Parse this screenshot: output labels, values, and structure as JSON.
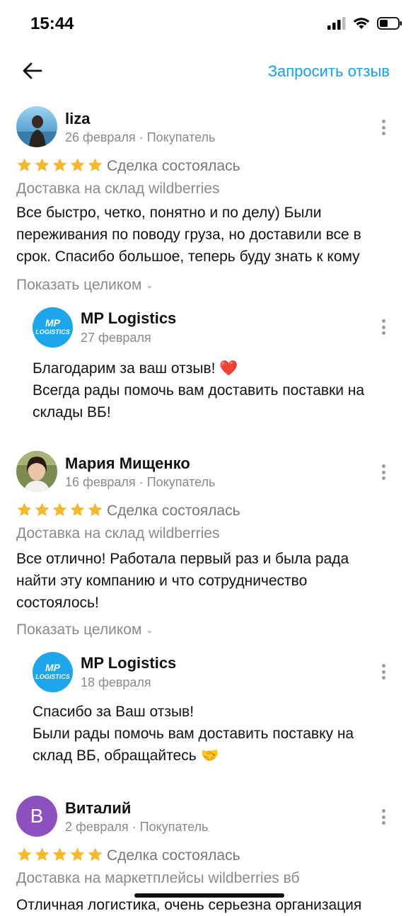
{
  "status_bar": {
    "time": "15:44"
  },
  "header": {
    "request_label": "Запросить отзыв"
  },
  "reviews": [
    {
      "name": "liza",
      "date": "26 февраля",
      "role": "Покупатель",
      "rating": 5,
      "deal_status": "Сделка состоялась",
      "service": "Доставка на склад wildberries",
      "text": "Все быстро, четко, понятно и по делу) Были переживания по поводу груза, но доставили все в срок. Спасибо большое, теперь буду знать к кому",
      "show_more": "Показать целиком",
      "reply": {
        "name": "MP Logistics",
        "date": "27 февраля",
        "logo_line1": "MP",
        "logo_line2": "LOGISTICS",
        "lines": [
          "Благодарим за ваш отзыв! ❤️",
          "Всегда рады помочь вам доставить поставки на склады ВБ!"
        ]
      }
    },
    {
      "name": "Мария Мищенко",
      "date": "16 февраля",
      "role": "Покупатель",
      "rating": 5,
      "deal_status": "Сделка состоялась",
      "service": "Доставка на склад wildberries",
      "text": "Все отлично! Работала первый раз и была рада найти эту компанию и что сотрудничество состоялось!",
      "show_more": "Показать целиком",
      "reply": {
        "name": "MP Logistics",
        "date": "18 февраля",
        "logo_line1": "MP",
        "logo_line2": "LOGISTICS",
        "lines": [
          "Спасибо за Ваш отзыв!",
          "Были рады помочь вам доставить поставку на склад ВБ, обращайтесь 🤝"
        ]
      }
    },
    {
      "name": "Виталий",
      "date": "2 февраля",
      "role": "Покупатель",
      "avatar_letter": "В",
      "rating": 5,
      "deal_status": "Сделка состоялась",
      "service": "Доставка на маркетплейсы wildberries вб",
      "text": "Отличная логистика, очень серьезна организация"
    }
  ],
  "colors": {
    "accent": "#1a9fe0",
    "star": "#f5b82e",
    "avatar_purple": "#8e4fbf",
    "logo_blue": "#1da6ea"
  },
  "icons": [
    "back-arrow-icon",
    "more-vertical-icon",
    "star-icon",
    "signal-icon",
    "wifi-icon",
    "battery-icon"
  ]
}
